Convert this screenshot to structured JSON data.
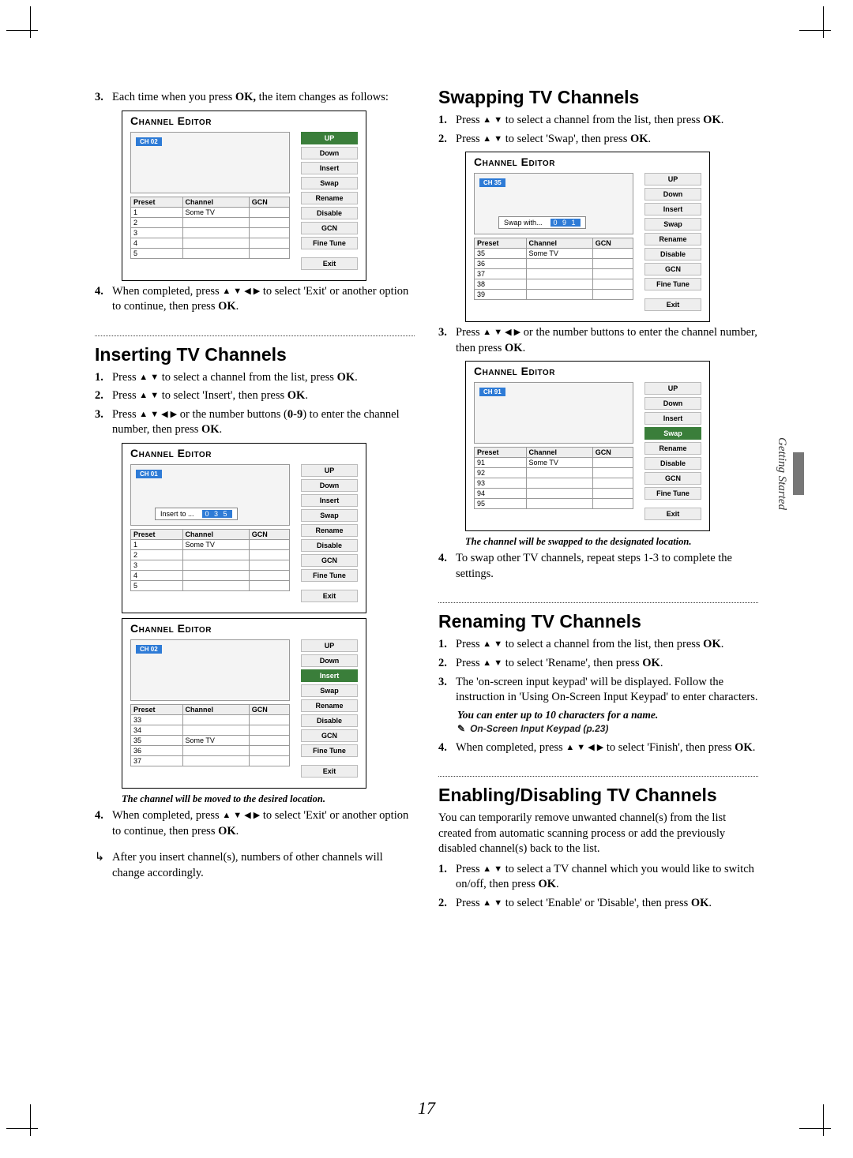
{
  "page_number": "17",
  "side_tab": "Getting Started",
  "arrows_ud": "▲ ▼",
  "arrows_all": "▲ ▼ ◀ ▶",
  "bold_ok": "OK",
  "left_col": {
    "intro_step": {
      "num": "3.",
      "text_a": "Each time when you press ",
      "bold": "OK,",
      "text_b": "  the item changes as follows:"
    },
    "editor1": {
      "title": "Channel Editor",
      "badge": "CH 02",
      "headers": [
        "Preset",
        "Channel",
        "GCN"
      ],
      "rows": [
        [
          "1",
          "Some TV",
          ""
        ],
        [
          "2",
          "",
          ""
        ],
        [
          "3",
          "",
          ""
        ],
        [
          "4",
          "",
          ""
        ],
        [
          "5",
          "",
          ""
        ]
      ],
      "menu": [
        "UP",
        "Down",
        "Insert",
        "Swap",
        "Rename",
        "Disable",
        "GCN",
        "Fine Tune"
      ],
      "hl_index": 0,
      "exit": "Exit"
    },
    "step4": {
      "num": "4.",
      "text_a": "When completed, press ",
      "text_b": " to select 'Exit' or another option to continue, then press ",
      "bold": "OK",
      "tail": "."
    },
    "section_insert": "Inserting TV Channels",
    "ins_steps": [
      {
        "num": "1.",
        "a": "Press ",
        "b": " to select a channel from the list, press ",
        "ok": "OK",
        "tail": "."
      },
      {
        "num": "2.",
        "a": "Press ",
        "b": " to select 'Insert', then press ",
        "ok": "OK",
        "tail": "."
      },
      {
        "num": "3.",
        "a": "Press ",
        "b": " or the number buttons (",
        "range": "0-9",
        "c": ") to enter the channel number, then press ",
        "ok": "OK",
        "tail": "."
      }
    ],
    "editor2": {
      "title": "Channel Editor",
      "badge": "CH 01",
      "popup_label": "Insert to ...",
      "popup_digits": "0 3 5",
      "headers": [
        "Preset",
        "Channel",
        "GCN"
      ],
      "rows": [
        [
          "1",
          "Some TV",
          ""
        ],
        [
          "2",
          "",
          ""
        ],
        [
          "3",
          "",
          ""
        ],
        [
          "4",
          "",
          ""
        ],
        [
          "5",
          "",
          ""
        ]
      ],
      "menu": [
        "UP",
        "Down",
        "Insert",
        "Swap",
        "Rename",
        "Disable",
        "GCN",
        "Fine Tune"
      ],
      "exit": "Exit"
    },
    "editor3": {
      "title": "Channel Editor",
      "badge": "CH 02",
      "headers": [
        "Preset",
        "Channel",
        "GCN"
      ],
      "rows": [
        [
          "33",
          "",
          ""
        ],
        [
          "34",
          "",
          ""
        ],
        [
          "35",
          "Some TV",
          ""
        ],
        [
          "36",
          "",
          ""
        ],
        [
          "37",
          "",
          ""
        ]
      ],
      "menu": [
        "UP",
        "Down",
        "Insert",
        "Swap",
        "Rename",
        "Disable",
        "GCN",
        "Fine Tune"
      ],
      "hl_index": 2,
      "exit": "Exit"
    },
    "caption": "The channel will be moved to the desired location.",
    "ins_step4": {
      "num": "4.",
      "a": "When completed, press ",
      "b": " to select 'Exit' or another option to continue, then press ",
      "ok": "OK",
      "tail": "."
    },
    "footnote": {
      "icon": "↳",
      "text": "After you insert channel(s), numbers of other channels will change accordingly."
    }
  },
  "right_col": {
    "section_swap": "Swapping TV Channels",
    "swap_steps12": [
      {
        "num": "1.",
        "a": "Press ",
        "b": " to select a channel from the list, then press ",
        "ok": "OK",
        "tail": "."
      },
      {
        "num": "2.",
        "a": "Press ",
        "b": " to select 'Swap', then press ",
        "ok": "OK",
        "tail": "."
      }
    ],
    "editor_swap1": {
      "title": "Channel Editor",
      "badge": "CH 35",
      "popup_label": "Swap with...",
      "popup_digits": "0 9 1",
      "headers": [
        "Preset",
        "Channel",
        "GCN"
      ],
      "rows": [
        [
          "35",
          "Some TV",
          ""
        ],
        [
          "36",
          "",
          ""
        ],
        [
          "37",
          "",
          ""
        ],
        [
          "38",
          "",
          ""
        ],
        [
          "39",
          "",
          ""
        ]
      ],
      "menu": [
        "UP",
        "Down",
        "Insert",
        "Swap",
        "Rename",
        "Disable",
        "GCN",
        "Fine Tune"
      ],
      "exit": "Exit"
    },
    "swap_step3": {
      "num": "3.",
      "a": "Press ",
      "b": " or the number buttons to enter the channel number, then press ",
      "ok": "OK",
      "tail": "."
    },
    "editor_swap2": {
      "title": "Channel Editor",
      "badge": "CH 91",
      "headers": [
        "Preset",
        "Channel",
        "GCN"
      ],
      "rows": [
        [
          "91",
          "Some TV",
          ""
        ],
        [
          "92",
          "",
          ""
        ],
        [
          "93",
          "",
          ""
        ],
        [
          "94",
          "",
          ""
        ],
        [
          "95",
          "",
          ""
        ]
      ],
      "menu": [
        "UP",
        "Down",
        "Insert",
        "Swap",
        "Rename",
        "Disable",
        "GCN",
        "Fine Tune"
      ],
      "hl_index": 3,
      "exit": "Exit"
    },
    "swap_caption": "The channel will be swapped to the designated location.",
    "swap_step4": {
      "num": "4.",
      "text": "To swap other TV channels, repeat steps 1-3 to complete the settings."
    },
    "section_rename": "Renaming TV Channels",
    "rename_steps": [
      {
        "num": "1.",
        "a": "Press ",
        "b": " to select a channel from the list, then press ",
        "ok": "OK",
        "tail": "."
      },
      {
        "num": "2.",
        "a": "Press ",
        "b": " to select 'Rename', then press ",
        "ok": "OK",
        "tail": "."
      },
      {
        "num": "3.",
        "text": "The 'on-screen input keypad' will be displayed. Follow the instruction in 'Using On-Screen Input Keypad' to enter characters."
      }
    ],
    "rename_em": "You can enter up to 10 characters for a name.",
    "rename_xref_icon": "✎",
    "rename_xref": "On-Screen Input Keypad (p.23)",
    "rename_step4": {
      "num": "4.",
      "a": "When completed, press ",
      "b": " to select 'Finish', then press ",
      "ok": "OK",
      "tail": "."
    },
    "section_enable": "Enabling/Disabling TV Channels",
    "enable_intro": "You can temporarily remove unwanted channel(s) from the list created from automatic scanning process or add the previously disabled channel(s) back to the list.",
    "enable_steps": [
      {
        "num": "1.",
        "a": "Press ",
        "b": " to select a TV channel which you would like to switch on/off, then press ",
        "ok": "OK",
        "tail": "."
      },
      {
        "num": "2.",
        "a": "Press ",
        "b": " to select 'Enable' or 'Disable', then press ",
        "ok": "OK",
        "tail": "."
      }
    ]
  }
}
